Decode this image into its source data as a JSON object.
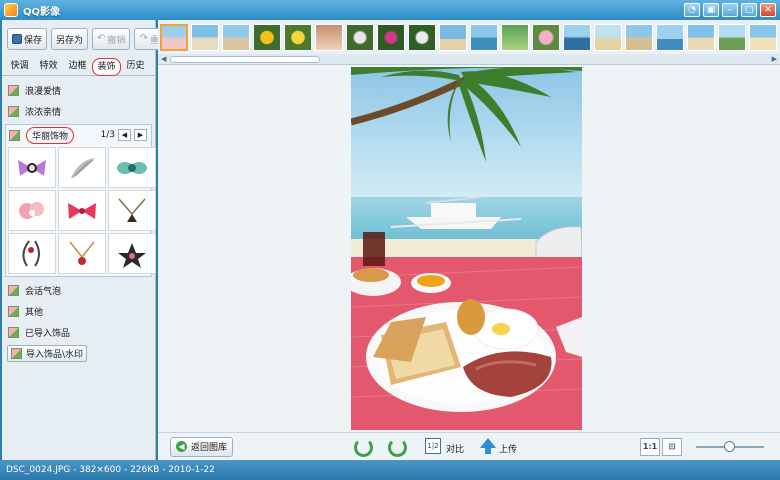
{
  "app": {
    "title": "QQ影像"
  },
  "toolbar": {
    "save": "保存",
    "save_as": "另存为",
    "undo": "撤销",
    "redo": "重做"
  },
  "tabs": [
    "快调",
    "特效",
    "边框",
    "装饰",
    "历史"
  ],
  "categories_top": [
    "浪漫爱情",
    "浓浓亲情"
  ],
  "open_category": {
    "label": "华丽饰物",
    "page": "1/3"
  },
  "categories_bottom": [
    "会话气泡",
    "其他",
    "已导入饰品"
  ],
  "import_button": "导入饰品\\水印",
  "bottombar": {
    "back": "返回图库",
    "compare": "对比",
    "upload": "上传",
    "zoom_actual": "1:1"
  },
  "status": "DSC_0024.JPG - 382×600 - 226KB - 2010-1-22"
}
